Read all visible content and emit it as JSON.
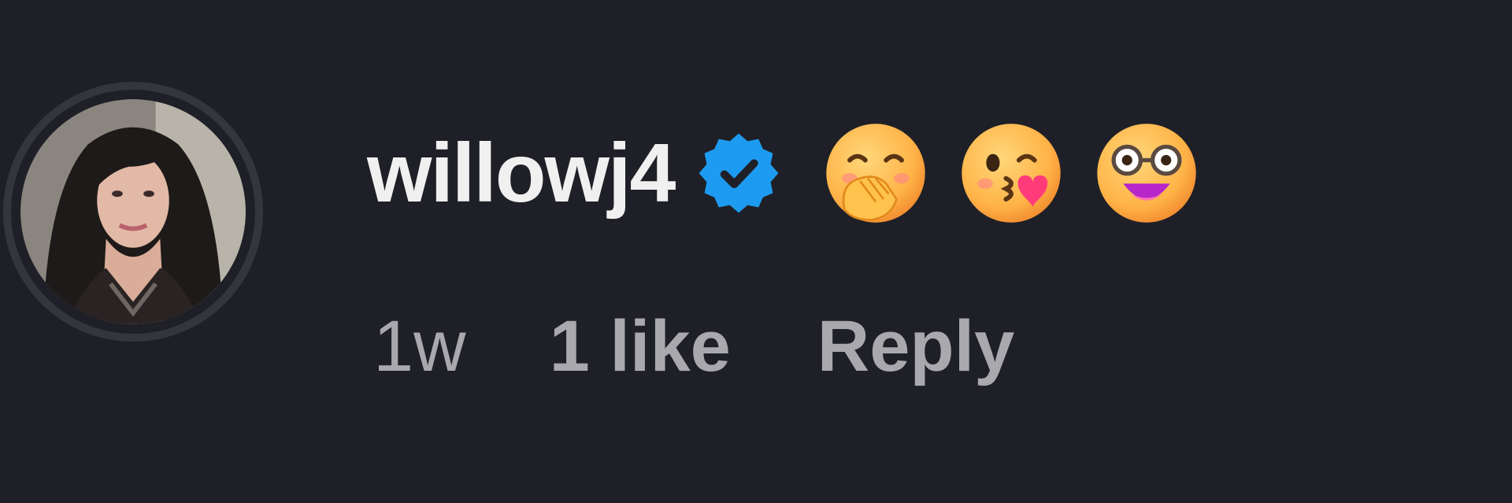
{
  "comment": {
    "username": "willowj4",
    "verified": true,
    "emojis": [
      "face-with-hand-over-mouth",
      "face-blowing-a-kiss",
      "nerd-face-with-glasses"
    ],
    "time": "1w",
    "likes": "1 like",
    "reply_label": "Reply"
  },
  "colors": {
    "background": "#1f2027",
    "username": "#f0f0f0",
    "meta": "#a8a8ad",
    "verified_badge": "#1d9bf0",
    "avatar_ring": "#35363d"
  }
}
